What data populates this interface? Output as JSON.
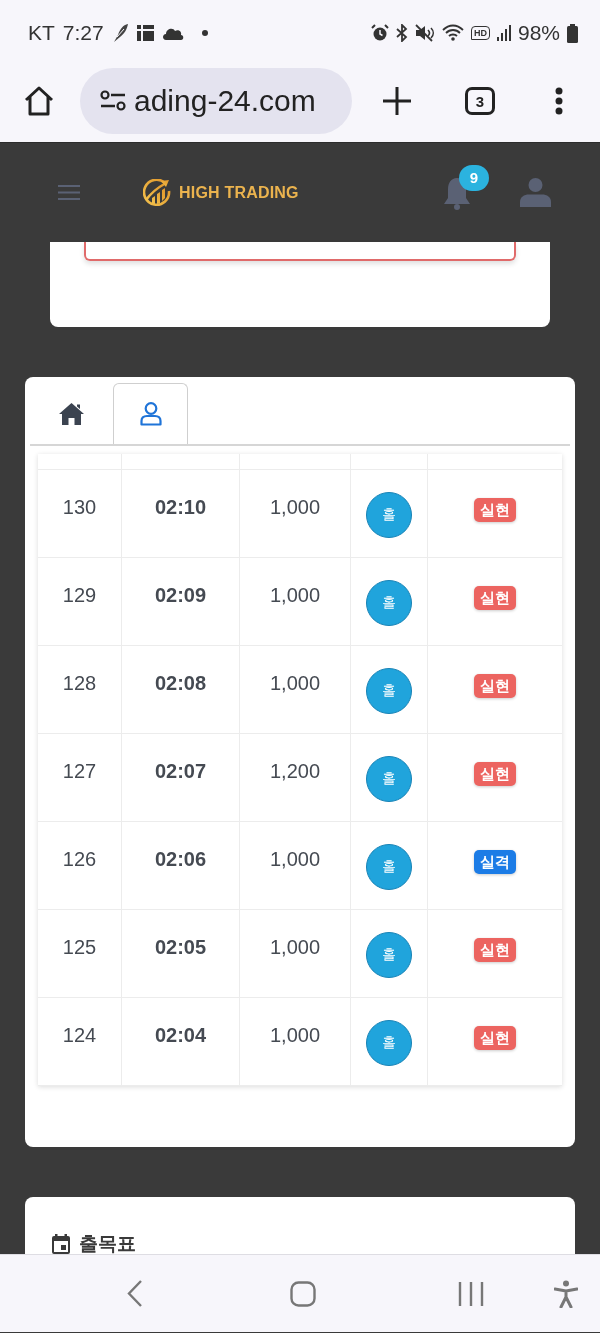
{
  "status_bar": {
    "carrier": "KT",
    "time": "7:27",
    "call_quality": "HD",
    "battery": "98%"
  },
  "browser": {
    "url": "ading-24.com",
    "tab_count": "3"
  },
  "header": {
    "logo": "HIGH TRADING",
    "notification_count": "9"
  },
  "tabs": [
    {
      "kind": "home",
      "selected": false
    },
    {
      "kind": "user",
      "selected": true
    }
  ],
  "table": {
    "rows": [
      {
        "number": "130",
        "time": "02:10",
        "amount": "1,000",
        "pick": "홀",
        "result": "실현",
        "color": "#ec6460"
      },
      {
        "number": "129",
        "time": "02:09",
        "amount": "1,000",
        "pick": "홀",
        "result": "실현",
        "color": "#ec6460"
      },
      {
        "number": "128",
        "time": "02:08",
        "amount": "1,000",
        "pick": "홀",
        "result": "실현",
        "color": "#ec6460"
      },
      {
        "number": "127",
        "time": "02:07",
        "amount": "1,200",
        "pick": "홀",
        "result": "실현",
        "color": "#ec6460"
      },
      {
        "number": "126",
        "time": "02:06",
        "amount": "1,000",
        "pick": "홀",
        "result": "실격",
        "color": "#1c7ce6"
      },
      {
        "number": "125",
        "time": "02:05",
        "amount": "1,000",
        "pick": "홀",
        "result": "실현",
        "color": "#ec6460"
      },
      {
        "number": "124",
        "time": "02:04",
        "amount": "1,000",
        "pick": "홀",
        "result": "실현",
        "color": "#ec6460"
      }
    ]
  },
  "attendance": {
    "title": "출목표"
  }
}
